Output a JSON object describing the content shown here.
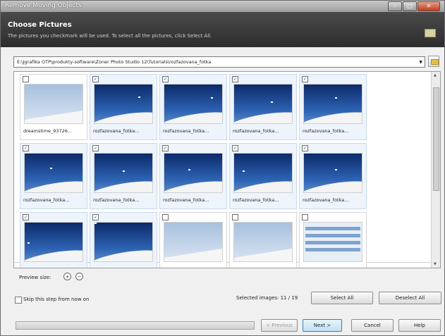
{
  "window": {
    "title": "Remove Moving Objects"
  },
  "header": {
    "title": "Choose Pictures",
    "subtitle": "The pictures you checkmark will be used. To select all the pictures, click Select All."
  },
  "path": {
    "value": "E:\\Jgrafika OTP\\produkty-software\\Zoner Photo Studio 12\\Tutorials\\rozfazovana_fotka"
  },
  "thumbnails": [
    {
      "caption": "dreamstime_93726...",
      "checked": false,
      "kind": "pale"
    },
    {
      "caption": "rozfazovana_fotka...",
      "checked": true,
      "kind": "night"
    },
    {
      "caption": "rozfazovana_fotka...",
      "checked": true,
      "kind": "night"
    },
    {
      "caption": "rozfazovana_fotka...",
      "checked": true,
      "kind": "night"
    },
    {
      "caption": "rozfazovana_fotka...",
      "checked": true,
      "kind": "night"
    },
    {
      "caption": "rozfazovana_fotka...",
      "checked": true,
      "kind": "night"
    },
    {
      "caption": "rozfazovana_fotka...",
      "checked": true,
      "kind": "night"
    },
    {
      "caption": "rozfazovana_fotka...",
      "checked": true,
      "kind": "night"
    },
    {
      "caption": "rozfazovana_fotka...",
      "checked": true,
      "kind": "night"
    },
    {
      "caption": "rozfazovana_fotka...",
      "checked": true,
      "kind": "night"
    },
    {
      "caption": "",
      "checked": true,
      "kind": "night"
    },
    {
      "caption": "",
      "checked": true,
      "kind": "night"
    },
    {
      "caption": "",
      "checked": false,
      "kind": "pale"
    },
    {
      "caption": "",
      "checked": false,
      "kind": "pale"
    },
    {
      "caption": "",
      "checked": false,
      "kind": "shot"
    }
  ],
  "preview": {
    "label": "Preview size:"
  },
  "skip": {
    "label": "Skip this step from now on"
  },
  "selection": {
    "label": "Selected images: 11 / 19"
  },
  "buttons": {
    "select_all": "Select All",
    "deselect_all": "Deselect All",
    "previous": "< Previous",
    "next": "Next >",
    "cancel": "Cancel",
    "help": "Help"
  },
  "icons": {
    "folder": "folder-icon",
    "zoom_in": "zoom-in-icon",
    "zoom_out": "zoom-out-icon",
    "header": "message-icon"
  }
}
